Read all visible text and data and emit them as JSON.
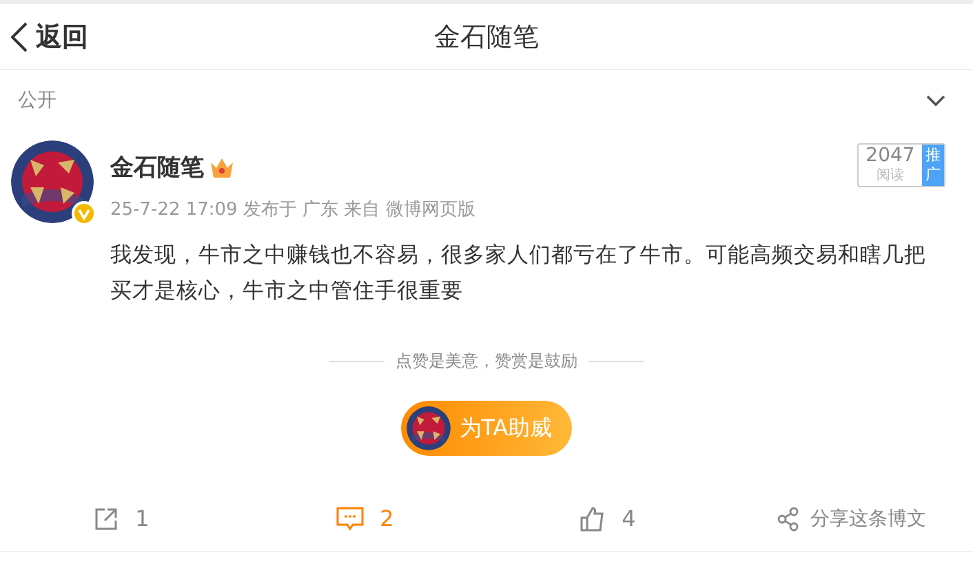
{
  "header": {
    "back_label": "返回",
    "title": "金石随笔"
  },
  "visibility": {
    "label": "公开"
  },
  "post": {
    "author": "金石随笔",
    "meta": "25-7-22 17:09 发布于 广东 来自 微博网页版",
    "reads": {
      "count": "2047",
      "label": "阅读",
      "promo": "推广"
    },
    "body": "我发现，牛市之中赚钱也不容易，很多家人们都亏在了牛市。可能高频交易和瞎几把买才是核心，牛市之中管住手很重要"
  },
  "reward": {
    "note": "点赞是美意，赞赏是鼓励",
    "button": "为TA助威"
  },
  "actions": [
    {
      "kind": "repost",
      "label": "1",
      "selected": false
    },
    {
      "kind": "comment",
      "label": "2",
      "selected": true
    },
    {
      "kind": "like",
      "label": "4",
      "selected": false
    },
    {
      "kind": "share",
      "label": "分享这条博文",
      "selected": false
    }
  ]
}
